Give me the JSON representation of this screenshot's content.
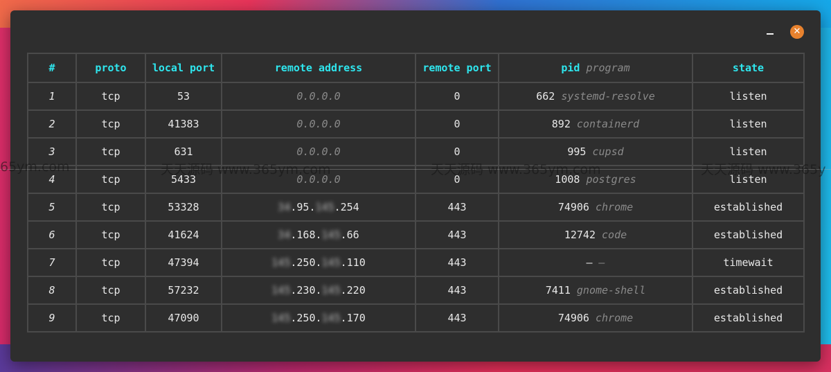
{
  "window": {
    "minimize_label": "_",
    "close_label": "✕",
    "close_color": "#e8822e",
    "header_color": "#2ee6ee"
  },
  "table": {
    "headers": {
      "index": "#",
      "proto": "proto",
      "local_port": "local port",
      "remote_address": "remote address",
      "remote_port": "remote port",
      "pid": "pid",
      "program": "program",
      "state": "state"
    },
    "rows": [
      {
        "index": "1",
        "proto": "tcp",
        "local_port": "53",
        "addr_a": "",
        "addr_b": "0.0.0.0",
        "addr_c": "",
        "addr_d": "",
        "addr_dim": true,
        "remote_port": "0",
        "pid": "662",
        "program": "systemd-resolve",
        "state": "listen"
      },
      {
        "index": "2",
        "proto": "tcp",
        "local_port": "41383",
        "addr_b": "0.0.0.0",
        "remote_port": "0",
        "pid": "892",
        "program": "containerd",
        "state": "listen"
      },
      {
        "index": "3",
        "proto": "tcp",
        "local_port": "631",
        "addr_b": "0.0.0.0",
        "remote_port": "0",
        "pid": "995",
        "program": "cupsd",
        "state": "listen"
      },
      {
        "index": "4",
        "proto": "tcp",
        "local_port": "5433",
        "addr_b": "0.0.0.0",
        "remote_port": "0",
        "pid": "1008",
        "program": "postgres",
        "state": "listen"
      },
      {
        "index": "5",
        "proto": "tcp",
        "local_port": "53328",
        "addr_a": "34",
        "addr_b": ".95.",
        "addr_c": "145",
        "addr_d": ".254",
        "remote_port": "443",
        "pid": "74906",
        "program": "chrome",
        "state": "established"
      },
      {
        "index": "6",
        "proto": "tcp",
        "local_port": "41624",
        "addr_a": "34",
        "addr_b": ".168.",
        "addr_c": "145",
        "addr_d": ".66",
        "remote_port": "443",
        "pid": "12742",
        "program": "code",
        "state": "established"
      },
      {
        "index": "7",
        "proto": "tcp",
        "local_port": "47394",
        "addr_a": "145",
        "addr_b": ".250.",
        "addr_c": "145",
        "addr_d": ".110",
        "remote_port": "443",
        "pid": "–",
        "program": "–",
        "state": "timewait"
      },
      {
        "index": "8",
        "proto": "tcp",
        "local_port": "57232",
        "addr_a": "145",
        "addr_b": ".230.",
        "addr_c": "145",
        "addr_d": ".220",
        "remote_port": "443",
        "pid": "7411",
        "program": "gnome-shell",
        "state": "established"
      },
      {
        "index": "9",
        "proto": "tcp",
        "local_port": "47090",
        "addr_a": "145",
        "addr_b": ".250.",
        "addr_c": "145",
        "addr_d": ".170",
        "remote_port": "443",
        "pid": "74906",
        "program": "chrome",
        "state": "established"
      }
    ]
  },
  "watermark": {
    "text_1": "65ym.com",
    "text_2": "天天源码 www.365ym.com",
    "text_3": "天天源码 www.365ym.com",
    "text_4": "天天源码 www.365y"
  }
}
